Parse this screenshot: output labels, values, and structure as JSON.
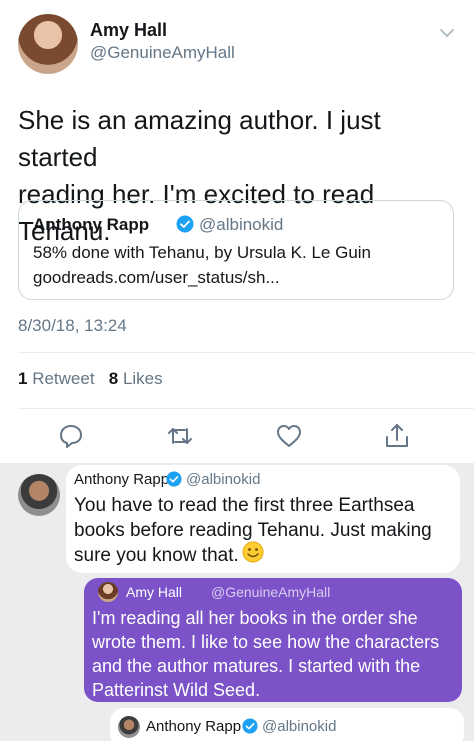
{
  "tweet": {
    "author_name": "Amy Hall",
    "author_handle": "@GenuineAmyHall",
    "text_line1": "She is an amazing author. I just started",
    "text_line2": "reading her.  I'm excited to read Tehanu.",
    "quoted": {
      "author_name": "Anthony Rapp",
      "author_handle": "@albinokid",
      "line1": "58% done with Tehanu, by Ursula K. Le Guin",
      "line2": "goodreads.com/user_status/sh..."
    },
    "timestamp": "8/30/18, 13:24",
    "retweets_count": "1",
    "retweets_label": "Retweet",
    "likes_count": "8",
    "likes_label": "Likes"
  },
  "thread": [
    {
      "author_name": "Anthony Rapp",
      "author_handle": "@albinokid",
      "text": "You have to read the first three Earthsea books before reading Tehanu. Just making sure you know that."
    },
    {
      "author_name": "Amy Hall",
      "author_handle": "@GenuineAmyHall",
      "text": "I'm reading all her books in the order she wrote them.  I like to see how the characters and the author matures.  I started with the Patterinst Wild Seed."
    },
    {
      "author_name": "Anthony Rapp",
      "author_handle": "@albinokid"
    }
  ],
  "icons": {
    "chevron": "chevron-down-icon",
    "verified": "verified-badge-icon",
    "reply": "reply-icon",
    "retweet": "retweet-icon",
    "like": "heart-icon",
    "share": "share-icon",
    "smiley": "smiley-emoji-icon"
  },
  "colors": {
    "verified_blue": "#1da1f2",
    "secondary_text": "#657786",
    "reply_bubble_purple": "#7b52c7",
    "thread_background": "#ececef"
  }
}
